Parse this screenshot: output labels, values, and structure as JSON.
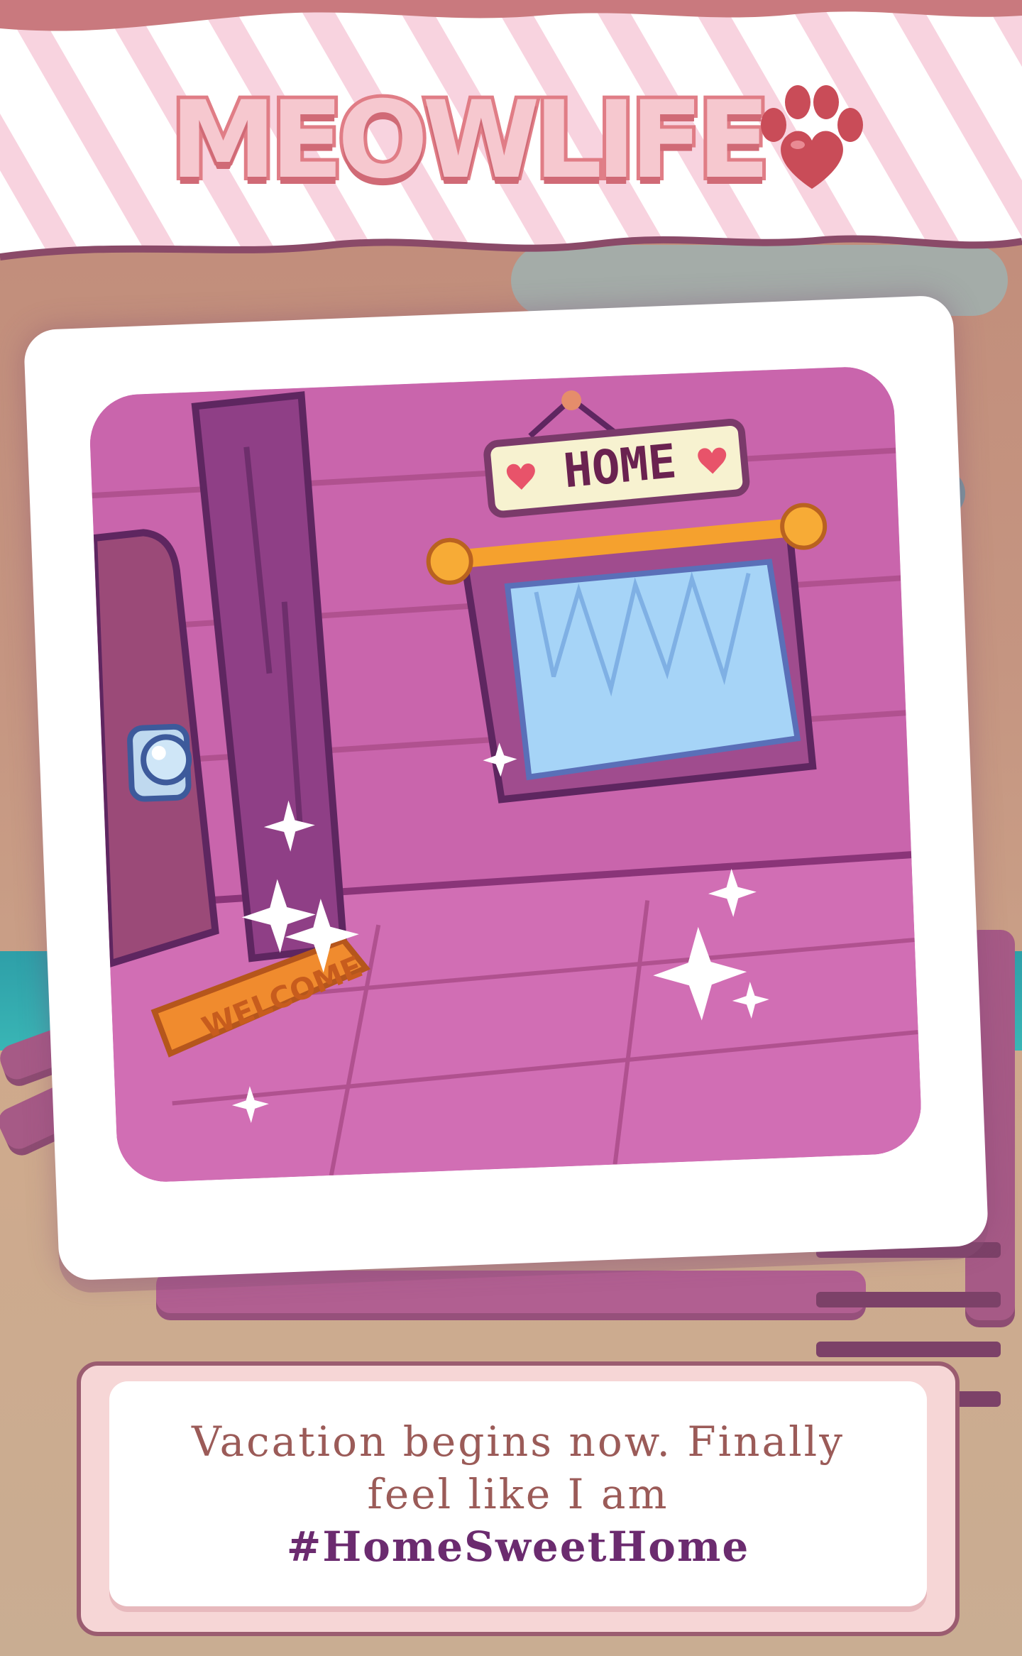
{
  "game": {
    "logo_text": "MEOWLIFE",
    "logo_icon": "paw-heart-icon"
  },
  "photo": {
    "sign_text": "HOME",
    "mat_text": "WELCOME",
    "scene": "cozy room with door, wooden pillar, curtained window, welcome mat and sparkles"
  },
  "caption": {
    "line1": "Vacation begins now. Finally",
    "line2": "feel like I am",
    "hashtag": "#HomeSweetHome"
  },
  "colors": {
    "banner_stripe": "#f6d0dc",
    "logo_pink": "#e07d86",
    "photo_wall": "#c861a8",
    "caption_text": "#9b5b58",
    "hashtag_text": "#6b2b6f"
  }
}
